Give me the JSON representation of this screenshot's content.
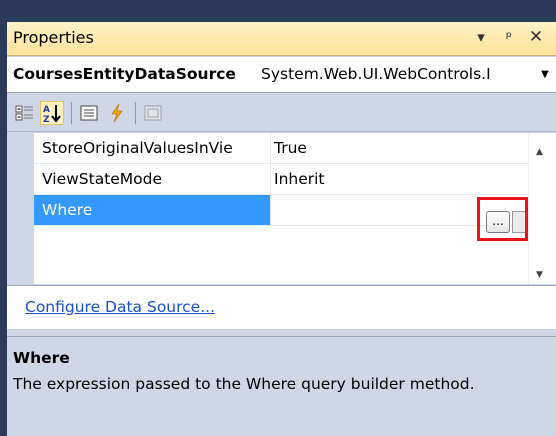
{
  "window": {
    "title": "Properties",
    "controls": {
      "dropdown_icon": "chevron-down",
      "pin_icon": "pin",
      "close_icon": "close"
    }
  },
  "object_selector": {
    "name": "CoursesEntityDataSource",
    "type": "System.Web.UI.WebControls.I"
  },
  "toolbar": {
    "buttons": [
      {
        "name": "categorized",
        "icon": "categorized-icon"
      },
      {
        "name": "alphabetical",
        "icon": "alphabetical-sort-icon",
        "active": true
      },
      {
        "name": "properties",
        "icon": "properties-icon"
      },
      {
        "name": "events",
        "icon": "events-lightning-icon"
      },
      {
        "name": "property-pages",
        "icon": "property-pages-icon",
        "disabled": true
      }
    ]
  },
  "grid": {
    "rows": [
      {
        "name": "StoreOriginalValuesInVie",
        "value": "True"
      },
      {
        "name": "ViewStateMode",
        "value": "Inherit"
      },
      {
        "name": "Where",
        "value": "",
        "selected": true
      }
    ],
    "ellipsis_label": "..."
  },
  "commands": {
    "link": "Configure Data Source..."
  },
  "description": {
    "title": "Where",
    "text": "The expression passed to the Where query builder method."
  },
  "colors": {
    "selection": "#3399ff",
    "highlight": "#e8141b",
    "link": "#1a4fcc",
    "titlebar": "#ffe29a"
  }
}
